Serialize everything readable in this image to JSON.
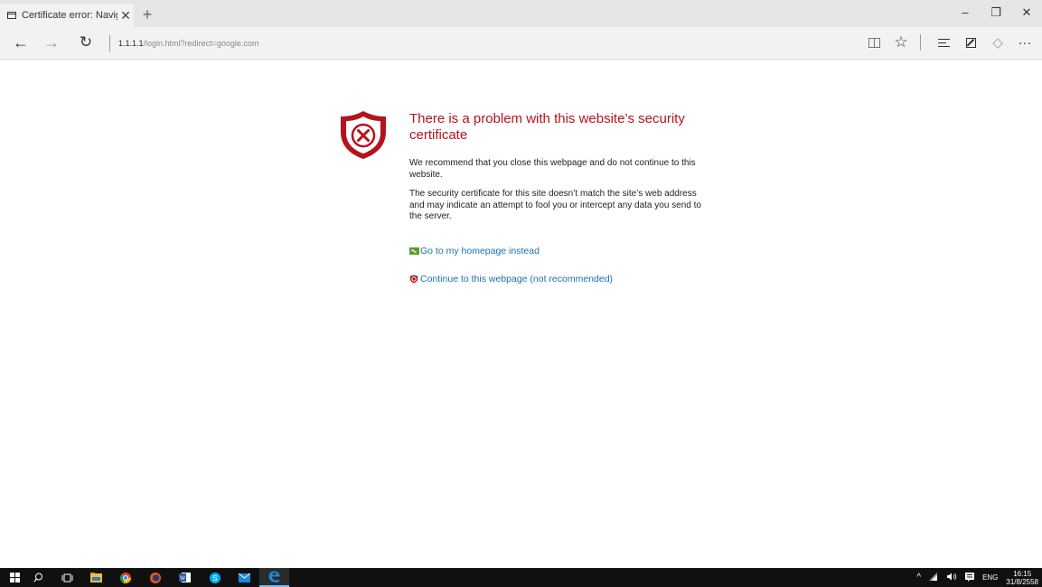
{
  "tab": {
    "title": "Certificate error: Navigat",
    "close": "✕",
    "new_tab": "+"
  },
  "window": {
    "minimize": "–",
    "maximize": "❐",
    "close": "✕"
  },
  "nav": {
    "back": "←",
    "forward": "→",
    "refresh": "↻",
    "address_host": "1.1.1.1",
    "address_path": "/login.html?redirect=google.com"
  },
  "toolbar": {
    "favorite": "☆",
    "share": "◇",
    "more": "···"
  },
  "error": {
    "title": "There is a problem with this website’s security certificate",
    "recommend": "We recommend that you close this webpage and do not continue to this website.",
    "detail": "The security certificate for this site doesn’t match the site’s web address and may indicate an attempt to fool you or intercept any data you send to the server.",
    "home_link": "Go to my homepage instead",
    "continue_link": "Continue to this webpage (not recommended)"
  },
  "colors": {
    "error_red": "#b5131d",
    "link_blue": "#1a6fb5",
    "taskbar": "#101010"
  },
  "tray": {
    "chevron": "^",
    "lang": "ENG",
    "time": "16:15",
    "date": "31/8/2558"
  }
}
